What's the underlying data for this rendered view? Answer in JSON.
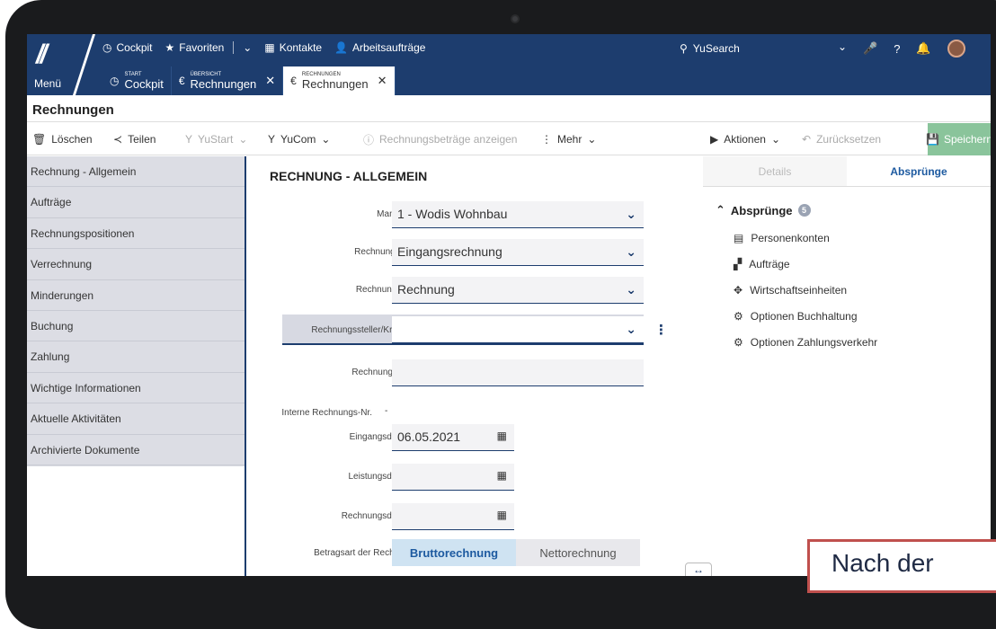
{
  "topbar": {
    "logo_text": "Menü",
    "nav": [
      {
        "icon": "clock-icon",
        "label": "Cockpit"
      },
      {
        "icon": "star-icon",
        "label": "Favoriten"
      },
      {
        "icon": "contacts-icon",
        "label": "Kontakte"
      },
      {
        "icon": "user-task-icon",
        "label": "Arbeitsaufträge"
      }
    ],
    "search_label": "YuSearch"
  },
  "tabs": [
    {
      "small": "START",
      "label": "Cockpit",
      "icon": "clock-icon"
    },
    {
      "small": "ÜBERSICHT",
      "label": "Rechnungen",
      "icon": "invoice-icon"
    },
    {
      "small": "RECHNUNGEN",
      "label": "Rechnungen",
      "icon": "invoice-icon"
    }
  ],
  "page_title": "Rechnungen",
  "toolbar": {
    "delete": "Löschen",
    "share": "Teilen",
    "yustart": "YuStart",
    "yucom": "YuCom",
    "show_amounts": "Rechnungsbeträge anzeigen",
    "more": "Mehr",
    "actions": "Aktionen",
    "reset": "Zurücksetzen",
    "save": "Speichern"
  },
  "sidebar": [
    "Rechnung - Allgemein",
    "Aufträge",
    "Rechnungspositionen",
    "Verrechnung",
    "Minderungen",
    "Buchung",
    "Zahlung",
    "Wichtige Informationen",
    "Aktuelle Aktivitäten",
    "Archivierte Dokumente"
  ],
  "form": {
    "title": "RECHNUNG - ALLGEMEIN",
    "mandant_label": "Mandant",
    "mandant_value": "1 - Wodis Wohnbau",
    "typ_label": "Rechnungstyp",
    "typ_value": "Eingangsrechnung",
    "art_label": "Rechnungsart",
    "art_value": "Rechnung",
    "steller_label": "Rechnungssteller/Kredi...",
    "nr_label": "Rechnungs-Nr.",
    "intern_label": "Interne Rechnungs-Nr.",
    "intern_value": "-",
    "eingang_label": "Eingangsdatum",
    "eingang_value": "06.05.2021",
    "leistung_label": "Leistungsdatum",
    "rdatum_label": "Rechnungsdatum",
    "betrag_label": "Betragsart der Rechnu...",
    "brutto": "Bruttorechnung",
    "netto": "Nettorechnung"
  },
  "right_panel": {
    "tab_details": "Details",
    "tab_absprunge": "Absprünge",
    "section": "Absprünge",
    "count": "5",
    "items": [
      "Personenkonten",
      "Aufträge",
      "Wirtschaftseinheiten",
      "Optionen Buchhaltung",
      "Optionen Zahlungsverkehr"
    ]
  },
  "overlay_text": "Nach der"
}
